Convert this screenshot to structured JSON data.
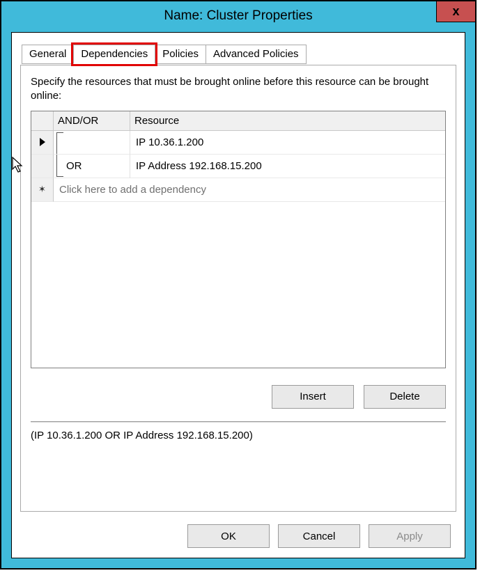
{
  "title": "Name: Cluster Properties",
  "close_x": "x",
  "tabs": {
    "general": "General",
    "dependencies": "Dependencies",
    "policies": "Policies",
    "advanced": "Advanced Policies"
  },
  "instruction": "Specify the resources that must be brought online before this resource can be brought online:",
  "grid": {
    "headers": {
      "andor": "AND/OR",
      "resource": "Resource"
    },
    "rows": [
      {
        "andor": "",
        "resource": "IP 10.36.1.200"
      },
      {
        "andor": "OR",
        "resource": "IP Address 192.168.15.200"
      }
    ],
    "new_row_hint": "Click here to add a dependency"
  },
  "buttons": {
    "insert": "Insert",
    "delete_": "Delete",
    "ok": "OK",
    "cancel": "Cancel",
    "apply": "Apply"
  },
  "summary": "(IP 10.36.1.200  OR IP Address 192.168.15.200)"
}
